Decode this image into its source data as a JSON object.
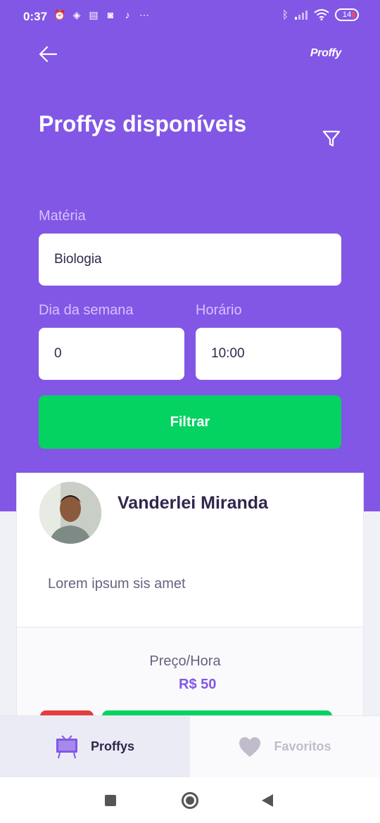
{
  "status_bar": {
    "time": "0:37",
    "battery": "14"
  },
  "header": {
    "brand": "Proffy",
    "title": "Proffys disponíveis"
  },
  "form": {
    "subject_label": "Matéria",
    "subject_value": "Biologia",
    "week_day_label": "Dia da semana",
    "week_day_value": "0",
    "time_label": "Horário",
    "time_value": "10:00",
    "submit_label": "Filtrar"
  },
  "teacher": {
    "name": "Vanderlei Miranda",
    "bio": "Lorem ipsum sis amet",
    "price_label": "Preço/Hora",
    "price_value": "R$ 50"
  },
  "tabs": [
    {
      "label": "Proffys",
      "icon": "tv-icon",
      "active": true
    },
    {
      "label": "Favoritos",
      "icon": "heart-icon",
      "active": false
    }
  ],
  "colors": {
    "primary": "#8257e5",
    "secondary": "#04d361",
    "danger": "#e33d3d",
    "title": "#32264d"
  }
}
